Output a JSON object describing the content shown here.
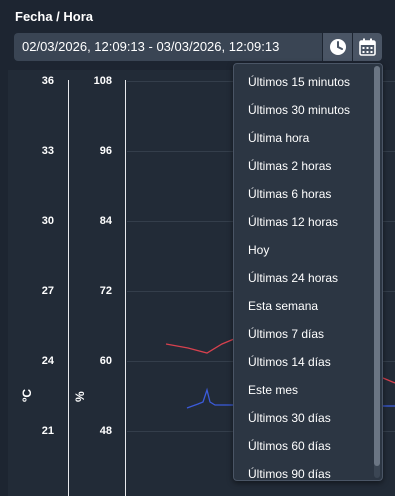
{
  "filter": {
    "label": "Fecha / Hora",
    "range_value": "02/03/2026, 12:09:13 - 03/03/2026, 12:09:13",
    "icons": [
      "clock-icon",
      "calendar-icon"
    ]
  },
  "chart": {
    "left_axis": {
      "unit": "ºC",
      "ticks": [
        "36",
        "33",
        "30",
        "27",
        "24",
        "21"
      ]
    },
    "right_axis": {
      "unit": "%",
      "ticks": [
        "108",
        "96",
        "84",
        "72",
        "60",
        "48"
      ]
    },
    "series_colors": {
      "temperature": "#d7414e",
      "humidity": "#3b5bdb"
    }
  },
  "presets": {
    "items": [
      "Últimos 15 minutos",
      "Últimos 30 minutos",
      "Última hora",
      "Últimas 2 horas",
      "Últimas 6 horas",
      "Últimas 12 horas",
      "Hoy",
      "Últimas 24 horas",
      "Esta semana",
      "Últimos 7 días",
      "Últimos 14 días",
      "Este mes",
      "Últimos 30 días",
      "Últimos 60 días",
      "Últimos 90 días"
    ]
  }
}
